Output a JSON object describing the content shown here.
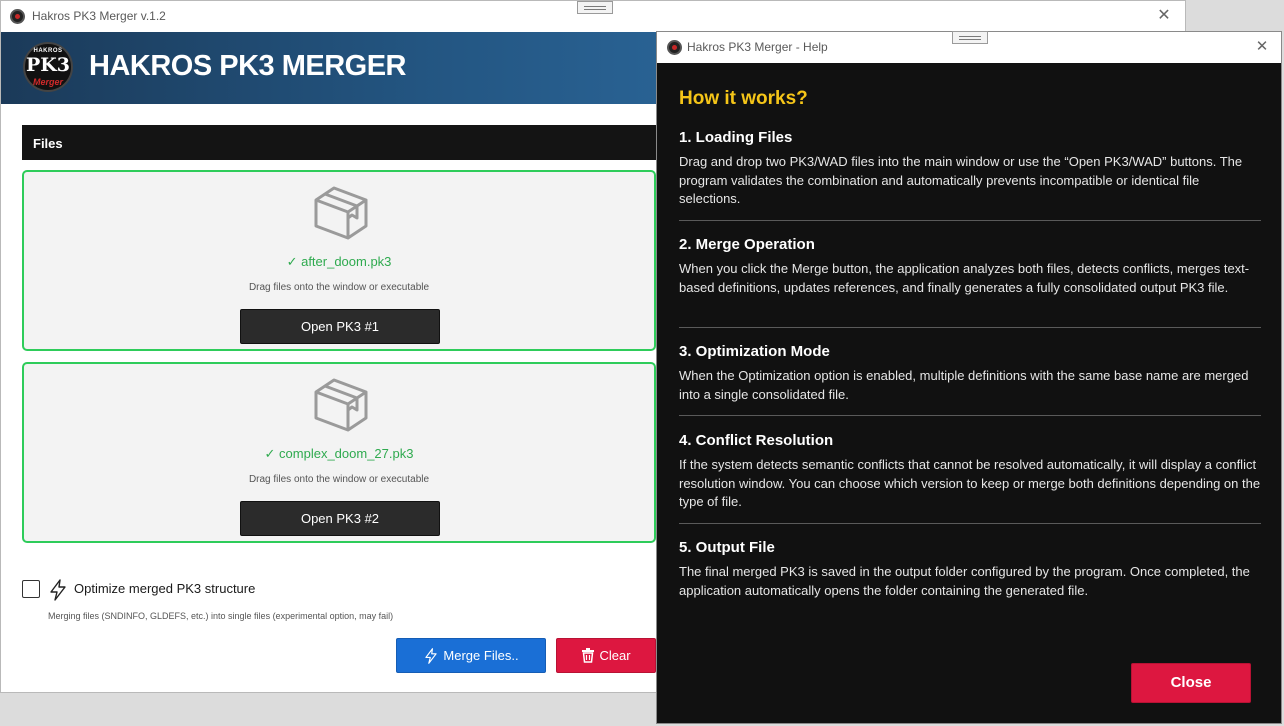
{
  "main_window": {
    "title": "Hakros PK3 Merger v.1.2",
    "banner": {
      "logo_top": "HAKROS",
      "logo_main": "PK3",
      "logo_sub": "Merger",
      "title": "HAKROS PK3 MERGER"
    },
    "files_header": "Files",
    "drop_zones": [
      {
        "file_name": "✓ after_doom.pk3",
        "hint": "Drag files onto the window or executable",
        "button_label": "Open PK3 #1"
      },
      {
        "file_name": "✓ complex_doom_27.pk3",
        "hint": "Drag files onto the window or executable",
        "button_label": "Open PK3 #2"
      }
    ],
    "optimize": {
      "checked": false,
      "label": "Optimize merged PK3 structure",
      "description": "Merging files (SNDINFO, GLDEFS, etc.) into single files (experimental option, may fail)"
    },
    "merge_button": "Merge Files..",
    "clear_button": "Clear",
    "colors": {
      "accent_green": "#2ecc5a",
      "merge_blue": "#1a6fd6",
      "clear_red": "#dd1740"
    }
  },
  "help_window": {
    "title": "Hakros PK3 Merger - Help",
    "heading": "How it works?",
    "sections": [
      {
        "title": "1. Loading Files",
        "body": "Drag and drop two PK3/WAD files into the main window or use the “Open PK3/WAD” buttons. The program validates the combination and automatically prevents incompatible or identical file selections."
      },
      {
        "title": "2. Merge Operation",
        "body": "When you click the Merge button, the application analyzes both files, detects conflicts, merges text-based definitions, updates references, and finally generates a fully consolidated output PK3 file."
      },
      {
        "title": "3. Optimization Mode",
        "body": "When the Optimization option is enabled, multiple definitions with the same base name are merged into a single consolidated file."
      },
      {
        "title": "4. Conflict Resolution",
        "body": "If the system detects semantic conflicts that cannot be resolved automatically, it will display a conflict resolution window. You can choose which version to keep or merge both definitions depending on the type of file."
      },
      {
        "title": "5. Output File",
        "body": "The final merged PK3 is saved in the output folder configured by the program. Once completed, the application automatically opens the folder containing the generated file."
      }
    ],
    "close_button": "Close",
    "colors": {
      "heading_yellow": "#f5c518",
      "background": "#111111"
    }
  }
}
